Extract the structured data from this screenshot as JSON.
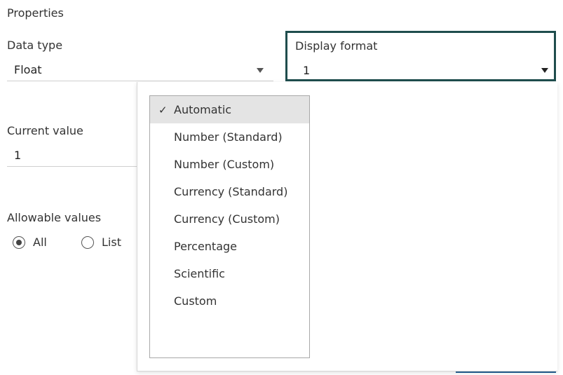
{
  "section_title": "Properties",
  "data_type": {
    "label": "Data type",
    "value": "Float"
  },
  "display_format": {
    "label": "Display format",
    "value": "1",
    "options": [
      {
        "label": "Automatic",
        "selected": true
      },
      {
        "label": "Number (Standard)",
        "selected": false
      },
      {
        "label": "Number (Custom)",
        "selected": false
      },
      {
        "label": "Currency (Standard)",
        "selected": false
      },
      {
        "label": "Currency (Custom)",
        "selected": false
      },
      {
        "label": "Percentage",
        "selected": false
      },
      {
        "label": "Scientific",
        "selected": false
      },
      {
        "label": "Custom",
        "selected": false
      }
    ],
    "check_glyph": "✓"
  },
  "current_value": {
    "label": "Current value",
    "value": "1"
  },
  "allowable_values": {
    "label": "Allowable values",
    "options": [
      {
        "label": "All",
        "checked": true
      },
      {
        "label": "List",
        "checked": false
      }
    ]
  },
  "colors": {
    "focus_border": "#1f4d4d",
    "selected_option_bg": "#e4e4e4",
    "accent": "#2a6496"
  }
}
